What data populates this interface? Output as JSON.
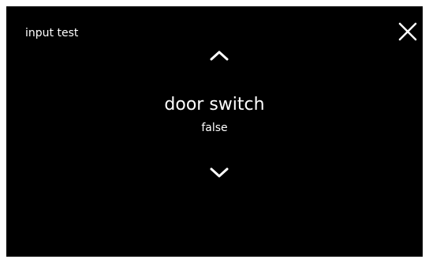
{
  "screen": {
    "title": "input test",
    "background_color": "#000000",
    "text_color": "#ffffff"
  },
  "controls": {
    "close_icon": "close-icon",
    "up_icon": "chevron-up-icon",
    "down_icon": "chevron-down-icon"
  },
  "input": {
    "name": "door switch",
    "value": "false"
  }
}
